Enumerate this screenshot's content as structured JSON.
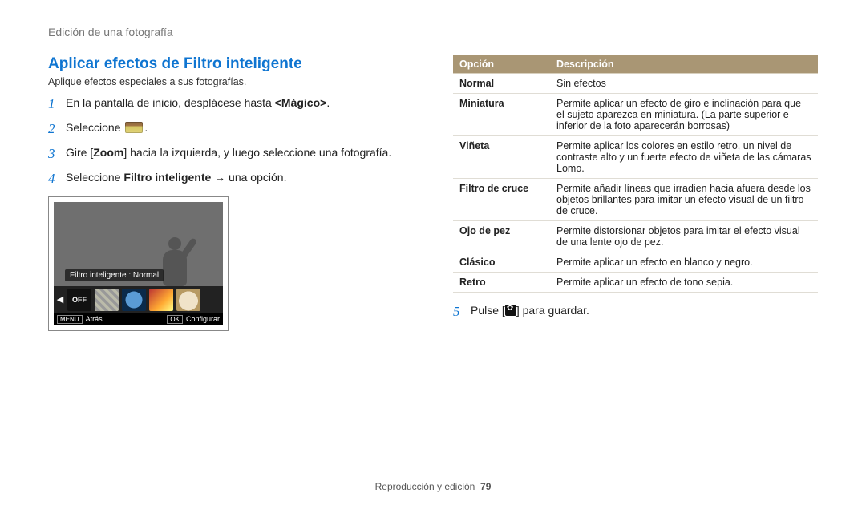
{
  "header": {
    "chapter": "Edición de una fotografía"
  },
  "left": {
    "title": "Aplicar efectos de Filtro inteligente",
    "intro": "Aplique efectos especiales a sus fotografías.",
    "steps": {
      "s1_pre": "En la pantalla de inicio, desplácese hasta ",
      "s1_bold": "<Mágico>",
      "s1_post": ".",
      "s2_pre": "Seleccione ",
      "s2_post": ".",
      "s3_pre": "Gire [",
      "s3_bold": "Zoom",
      "s3_post": "] hacia la izquierda, y luego seleccione una fotografía.",
      "s4_pre": "Seleccione ",
      "s4_bold": "Filtro inteligente",
      "s4_post": " → una opción."
    },
    "camera": {
      "caption": "Filtro inteligente : Normal",
      "off_label": "OFF",
      "menu_label": "MENU",
      "back_label": "Atrás",
      "ok_label": "OK",
      "config_label": "Configurar"
    }
  },
  "right": {
    "table": {
      "col_option": "Opción",
      "col_desc": "Descripción",
      "rows": [
        {
          "name": "Normal",
          "desc": "Sin efectos"
        },
        {
          "name": "Miniatura",
          "desc": "Permite aplicar un efecto de giro e inclinación para que el sujeto aparezca en miniatura. (La parte superior e inferior de la foto aparecerán borrosas)"
        },
        {
          "name": "Viñeta",
          "desc": "Permite aplicar los colores en estilo retro, un nivel de contraste alto y un fuerte efecto de viñeta de las cámaras Lomo."
        },
        {
          "name": "Filtro de cruce",
          "desc": "Permite añadir líneas que irradien hacia afuera desde los objetos brillantes para imitar un efecto visual de un filtro de cruce."
        },
        {
          "name": "Ojo de pez",
          "desc": "Permite distorsionar objetos para imitar el efecto visual de una lente ojo de pez."
        },
        {
          "name": "Clásico",
          "desc": "Permite aplicar un efecto en blanco y negro."
        },
        {
          "name": "Retro",
          "desc": "Permite aplicar un efecto de tono sepia."
        }
      ]
    },
    "step5_pre": "Pulse [",
    "step5_post": "] para guardar."
  },
  "footer": {
    "section": "Reproducción y edición",
    "page": "79"
  }
}
